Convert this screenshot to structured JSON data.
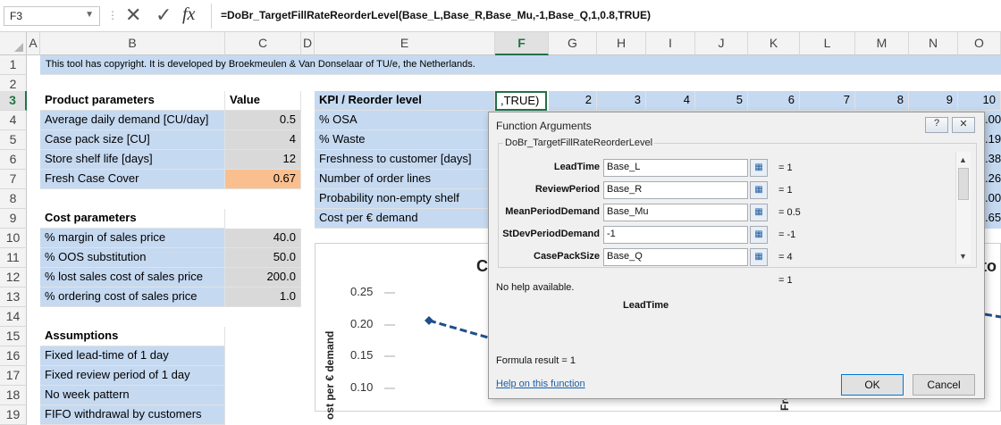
{
  "formula_bar": {
    "namebox": "F3",
    "formula": "=DoBr_TargetFillRateReorderLevel(Base_L,Base_R,Base_Mu,-1,Base_Q,1,0.8,TRUE)",
    "cancel_glyph": "✕",
    "enter_glyph": "✓",
    "fx_label": "fx"
  },
  "columns": [
    "A",
    "B",
    "C",
    "D",
    "E",
    "F",
    "G",
    "H",
    "I",
    "J",
    "K",
    "L",
    "M",
    "N",
    "O"
  ],
  "rows": [
    "1",
    "2",
    "3",
    "4",
    "5",
    "6",
    "7",
    "8",
    "9",
    "10",
    "11",
    "12",
    "13",
    "14",
    "15",
    "16",
    "17",
    "18",
    "19"
  ],
  "banner": "This tool has copyright. It is developed by Broekmeulen & Van Donselaar of TU/e, the Netherlands.",
  "product_section": {
    "header": "Product parameters",
    "value_header": "Value",
    "items": [
      {
        "label": "Average daily demand [CU/day]",
        "value": "0.5"
      },
      {
        "label": "Case pack size [CU]",
        "value": "4"
      },
      {
        "label": "Store shelf life [days]",
        "value": "12"
      },
      {
        "label": "Fresh Case Cover",
        "value": "0.67"
      }
    ]
  },
  "cost_section": {
    "header": "Cost parameters",
    "items": [
      {
        "label": "% margin of sales price",
        "value": "40.0"
      },
      {
        "label": "% OOS substitution",
        "value": "50.0"
      },
      {
        "label": "% lost sales cost of sales price",
        "value": "200.0"
      },
      {
        "label": "% ordering cost of sales price",
        "value": "1.0"
      }
    ]
  },
  "assumptions": {
    "header": "Assumptions",
    "items": [
      "Fixed lead-time of 1 day",
      "Fixed review period  of 1 day",
      "No week pattern",
      "FIFO withdrawal by customers"
    ]
  },
  "kpi": {
    "header": "KPI / Reorder level",
    "active_cell": ",TRUE)",
    "levels": [
      "2",
      "3",
      "4",
      "5",
      "6",
      "7",
      "8",
      "9",
      "10"
    ],
    "items": [
      "% OSA",
      "% Waste",
      "Freshness to customer [days]",
      "Number of order lines",
      "Probability non-empty shelf",
      "Cost per € demand"
    ],
    "o_partial": [
      ".00",
      ".19",
      ".38",
      ".26",
      ".00",
      ".65"
    ]
  },
  "chart": {
    "title_left": "C",
    "title_right": "to",
    "ylabel": "ost per € demand",
    "ylabel_right": "Fre",
    "yticks": [
      "0.25",
      "0.20",
      "0.15",
      "0.10"
    ]
  },
  "dialog": {
    "title": "Function Arguments",
    "help_btn": "?",
    "close_btn": "✕",
    "function_name": "DoBr_TargetFillRateReorderLevel",
    "args": [
      {
        "label": "LeadTime",
        "value": "Base_L",
        "result": "=  1"
      },
      {
        "label": "ReviewPeriod",
        "value": "Base_R",
        "result": "=  1"
      },
      {
        "label": "MeanPeriodDemand",
        "value": "Base_Mu",
        "result": "=  0.5"
      },
      {
        "label": "StDevPeriodDemand",
        "value": "-1",
        "result": "=  -1"
      },
      {
        "label": "CasePackSize",
        "value": "Base_Q",
        "result": "=  4"
      }
    ],
    "total_result": "=  1",
    "help_text": "No help available.",
    "current_arg": "LeadTime",
    "formula_result": "Formula result =   1",
    "help_link": "Help on this function",
    "ok_label": "OK",
    "cancel_label": "Cancel"
  }
}
